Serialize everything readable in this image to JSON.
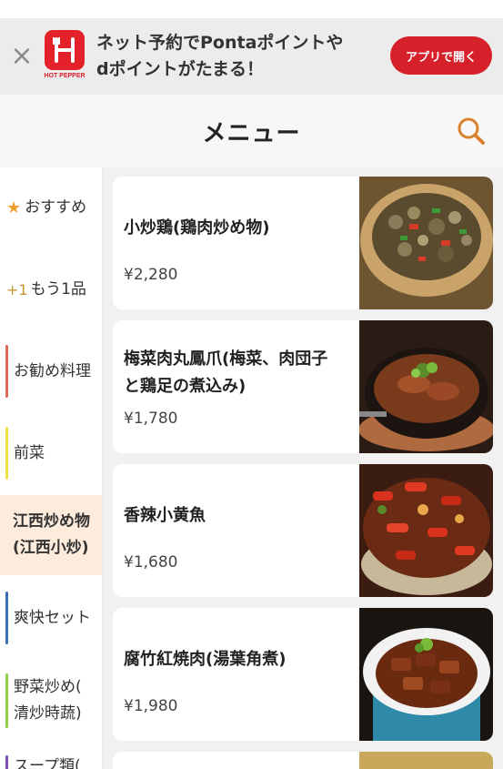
{
  "banner": {
    "close": "×",
    "logo_text": "HOT PEPPER",
    "line1": "ネット予約でPontaポイントや",
    "line2": "dポイントがたまる！",
    "cta": "アプリで開く"
  },
  "header": {
    "title": "メニュー"
  },
  "sidebar": {
    "items": [
      {
        "label": "おすすめ",
        "prefix": "★",
        "prefix_color": "#f0a030"
      },
      {
        "label": "もう1品",
        "prefix": "+1",
        "prefix_color": "#c9962f"
      },
      {
        "label": "お勧め料理",
        "bar_color": "#e06a5a"
      },
      {
        "label": "前菜",
        "bar_color": "#f2e04a"
      },
      {
        "label": "江西炒め物(江西小炒)",
        "line1": "江西炒め物",
        "line2": "(江西小炒)",
        "active": true
      },
      {
        "label": "爽快セット",
        "bar_color": "#3a6fb8"
      },
      {
        "label": "野菜炒め(清炒時蔬)",
        "line1": "野菜炒め(",
        "line2": "清炒時蔬)",
        "bar_color": "#8fd24a"
      },
      {
        "label": "スープ類(",
        "bar_color": "#7a4fb0"
      }
    ]
  },
  "menu": [
    {
      "name": "小炒鶏(鶏肉炒め物)",
      "price": "¥2,280"
    },
    {
      "name": "梅菜肉丸鳳爪(梅菜、肉団子と鶏足の煮込み)",
      "name_l1": "梅菜肉丸鳳爪(梅菜、肉団子",
      "name_l2": "と鶏足の煮込み)",
      "price": "¥1,780"
    },
    {
      "name": "香辣小黄魚",
      "price": "¥1,680"
    },
    {
      "name": "腐竹紅焼肉(湯葉角煮)",
      "price": "¥1,980"
    }
  ],
  "colors": {
    "brand_red": "#d6202a",
    "active_bg": "#fdebdb",
    "search_icon": "#d9822b"
  },
  "icons": [
    "close-icon",
    "hot-pepper-logo",
    "search-icon",
    "star-icon"
  ]
}
